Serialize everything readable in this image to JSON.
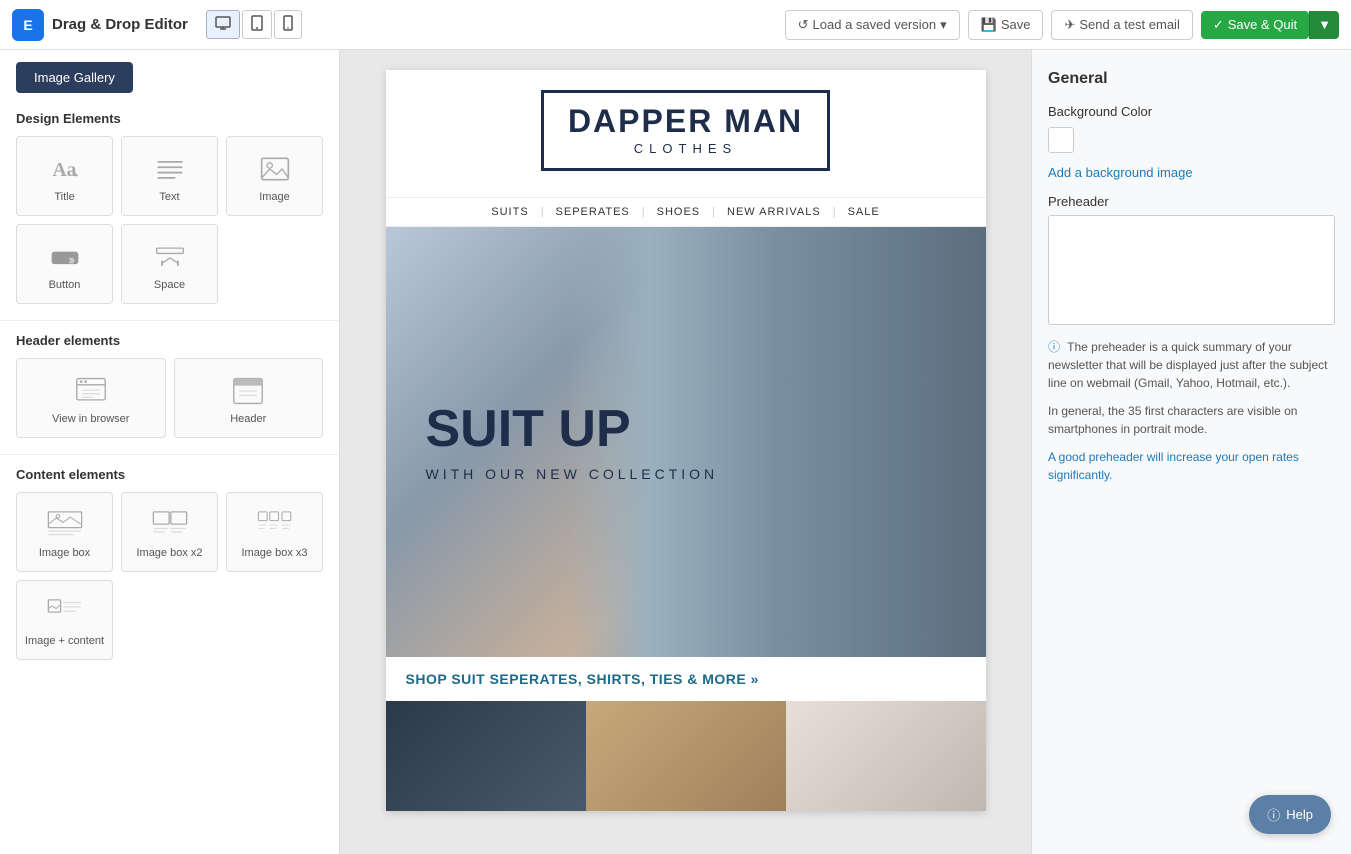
{
  "topbar": {
    "app_name": "Drag & Drop Editor",
    "device_buttons": [
      "desktop",
      "tablet",
      "mobile"
    ],
    "load_label": "Load a saved version",
    "save_label": "Save",
    "test_label": "Send a test email",
    "savequit_label": "Save & Quit"
  },
  "left_panel": {
    "gallery_btn_label": "Image Gallery",
    "design_elements_title": "Design Elements",
    "design_elements": [
      {
        "id": "title",
        "label": "Title"
      },
      {
        "id": "text",
        "label": "Text"
      },
      {
        "id": "image",
        "label": "Image"
      },
      {
        "id": "button",
        "label": "Button"
      },
      {
        "id": "space",
        "label": "Space"
      }
    ],
    "header_elements_title": "Header elements",
    "header_elements": [
      {
        "id": "view-in-browser",
        "label": "View in browser"
      },
      {
        "id": "header",
        "label": "Header"
      }
    ],
    "content_elements_title": "Content elements",
    "content_elements": [
      {
        "id": "image-box",
        "label": "Image box"
      },
      {
        "id": "image-box-x2",
        "label": "Image box x2"
      },
      {
        "id": "image-box-x3",
        "label": "Image box x3"
      },
      {
        "id": "image-content",
        "label": "Image + content"
      }
    ]
  },
  "canvas": {
    "brand_name": "DAPPER MAN",
    "brand_sub": "CLOTHES",
    "nav_items": [
      "SUITS",
      "|",
      "SEPERATES",
      "|",
      "SHOES",
      "|",
      "NEW ARRIVALS",
      "|",
      "SALE"
    ],
    "hero_title_line1": "SUIT UP",
    "hero_subtitle": "WITH OUR NEW COLLECTION",
    "shop_link_text": "SHOP SUIT SEPERATES, SHIRTS, TIES & MORE »"
  },
  "right_panel": {
    "general_title": "General",
    "background_color_label": "Background Color",
    "add_bg_image_label": "Add a background image",
    "preheader_label": "Preheader",
    "preheader_placeholder": "",
    "info_text": "The preheader is a quick summary of your newsletter that will be displayed just after the subject line on webmail (Gmail, Yahoo, Hotmail, etc.).",
    "info_text2": "In general, the 35 first characters are visible on smartphones in portrait mode.",
    "info_text3": "A good preheader will increase your open rates significantly."
  },
  "help_btn_label": "Help"
}
